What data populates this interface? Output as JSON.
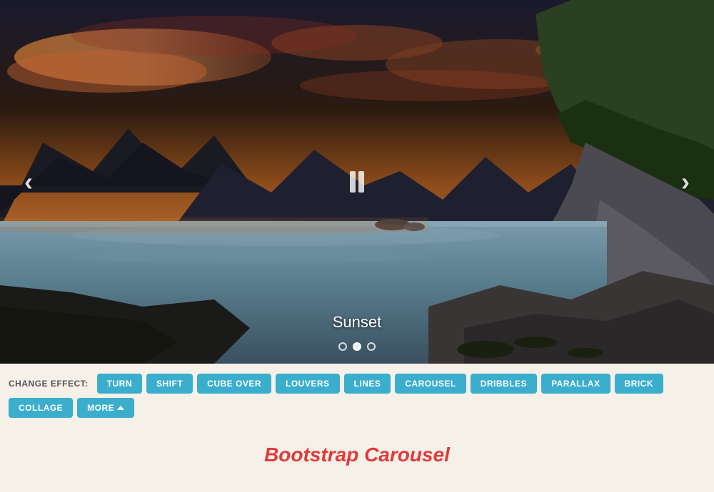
{
  "carousel": {
    "caption": "Sunset",
    "dots": [
      {
        "active": false,
        "index": 0
      },
      {
        "active": true,
        "index": 1
      },
      {
        "active": false,
        "index": 2
      }
    ],
    "prev_arrow": "‹",
    "next_arrow": "›"
  },
  "effects_bar": {
    "label": "CHANGE EFFECT:",
    "buttons": [
      {
        "id": "turn",
        "label": "TURN"
      },
      {
        "id": "shift",
        "label": "SHIFT"
      },
      {
        "id": "cube-over",
        "label": "CUBE OVER"
      },
      {
        "id": "louvers",
        "label": "LOUVERS"
      },
      {
        "id": "lines",
        "label": "LINES"
      },
      {
        "id": "carousel",
        "label": "CAROUSEL"
      },
      {
        "id": "dribbles",
        "label": "DRIBBLES"
      },
      {
        "id": "parallax",
        "label": "PARALLAX"
      },
      {
        "id": "brick",
        "label": "BRICK"
      },
      {
        "id": "collage",
        "label": "COLLAGE"
      }
    ],
    "more_label": "MORE"
  },
  "footer": {
    "title": "Bootstrap Carousel"
  }
}
